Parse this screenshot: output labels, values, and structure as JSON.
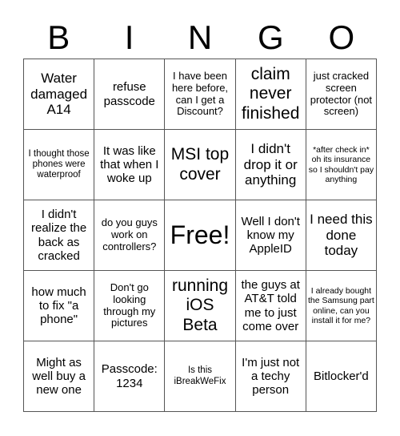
{
  "header": {
    "letters": [
      "B",
      "I",
      "N",
      "G",
      "O"
    ]
  },
  "cells": [
    {
      "text": "Water damaged A14",
      "size": "s-ml"
    },
    {
      "text": "refuse passcode",
      "size": "s-m"
    },
    {
      "text": "I have been here before, can I get a Discount?",
      "size": "s-s"
    },
    {
      "text": "claim never finished",
      "size": "s-l"
    },
    {
      "text": "just cracked screen protector (not screen)",
      "size": "s-s"
    },
    {
      "text": "I thought those phones were waterproof",
      "size": "s-xs"
    },
    {
      "text": "It was like that when I woke up",
      "size": "s-m"
    },
    {
      "text": "MSI top cover",
      "size": "s-l"
    },
    {
      "text": "I didn't drop it or anything",
      "size": "s-ml"
    },
    {
      "text": "*after check in* oh its insurance so I shouldn't pay anything",
      "size": "s-xxs"
    },
    {
      "text": "I didn't realize the back as cracked",
      "size": "s-m"
    },
    {
      "text": "do you guys work on controllers?",
      "size": "s-s"
    },
    {
      "text": "Free!",
      "size": "s-xl"
    },
    {
      "text": "Well I don't know my AppleID",
      "size": "s-m"
    },
    {
      "text": "I need this done today",
      "size": "s-ml"
    },
    {
      "text": "how much to fix \"a phone\"",
      "size": "s-m"
    },
    {
      "text": "Don't go looking through my pictures",
      "size": "s-s"
    },
    {
      "text": "running iOS Beta",
      "size": "s-l"
    },
    {
      "text": "the guys at AT&T told me to just come over",
      "size": "s-m"
    },
    {
      "text": "I already bought the Samsung part online, can you install it for me?",
      "size": "s-xxs"
    },
    {
      "text": "Might as well buy a new one",
      "size": "s-m"
    },
    {
      "text": "Passcode: 1234",
      "size": "s-m"
    },
    {
      "text": "Is this iBreakWeFix",
      "size": "s-xs"
    },
    {
      "text": "I'm just not a techy person",
      "size": "s-m"
    },
    {
      "text": "Bitlocker'd",
      "size": "s-m"
    }
  ]
}
